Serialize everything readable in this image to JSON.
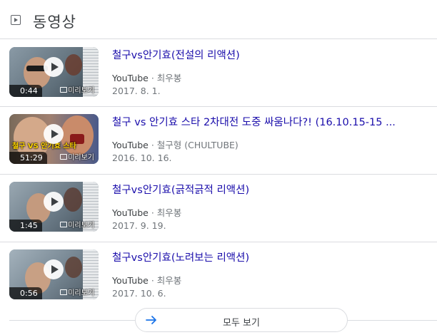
{
  "header": {
    "title": "동영상",
    "icon": "video-play-icon"
  },
  "videos": [
    {
      "title": "철구vs안기효(전설의 리액션)",
      "source": "YouTube",
      "channel": "최우봉",
      "date": "2017. 8. 1.",
      "duration": "0:44",
      "preview_label": "미리보기"
    },
    {
      "title": "철구 vs 안기효 스타 2차대전 도중 싸움나다?! (16.10.15-15 ...",
      "source": "YouTube",
      "channel": "철구형 (CHULTUBE)",
      "date": "2016. 10. 16.",
      "duration": "51:29",
      "preview_label": "미리보기",
      "overlay_text": "철구 VS 안기효 스타"
    },
    {
      "title": "철구vs안기효(긁적긁적 리액션)",
      "source": "YouTube",
      "channel": "최우봉",
      "date": "2017. 9. 19.",
      "duration": "1:45",
      "preview_label": "미리보기"
    },
    {
      "title": "철구vs안기효(노려보는 리액션)",
      "source": "YouTube",
      "channel": "최우봉",
      "date": "2017. 10. 6.",
      "duration": "0:56",
      "preview_label": "미리보기"
    }
  ],
  "separator": "·",
  "more_button": {
    "label": "모두 보기",
    "icon": "arrow-right-icon"
  },
  "colors": {
    "link": "#1a0dab",
    "meta": "#70757a",
    "divider": "#dadce0",
    "accent_arrow": "#1a73e8"
  }
}
